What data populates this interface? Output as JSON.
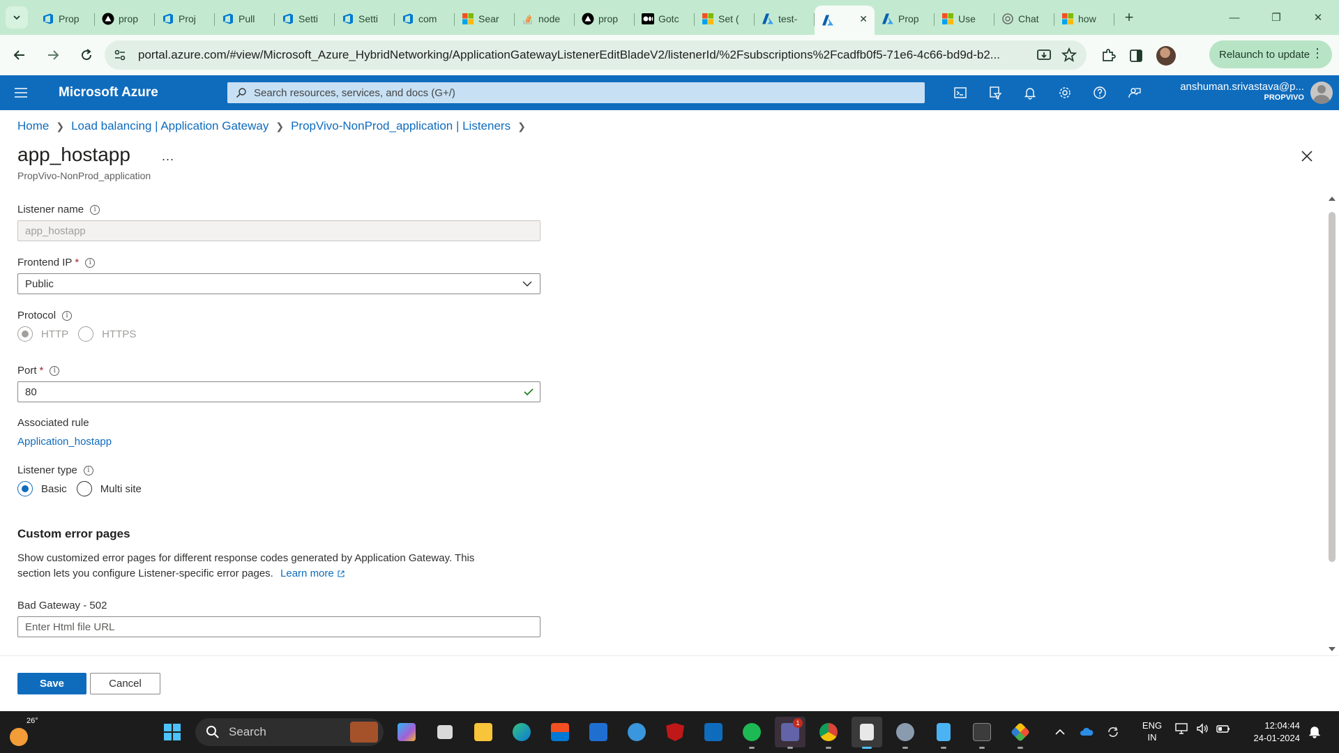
{
  "browser": {
    "tabs": [
      {
        "title": "Prop",
        "icon": "azure-devops-icon",
        "color": "#0078d4"
      },
      {
        "title": "prop",
        "icon": "vercel-icon",
        "color": "#000000"
      },
      {
        "title": "Proj",
        "icon": "azure-devops-icon",
        "color": "#0078d4"
      },
      {
        "title": "Pull",
        "icon": "azure-devops-icon",
        "color": "#0078d4"
      },
      {
        "title": "Setti",
        "icon": "azure-devops-icon",
        "color": "#0078d4"
      },
      {
        "title": "Setti",
        "icon": "azure-devops-icon",
        "color": "#0078d4"
      },
      {
        "title": "com",
        "icon": "azure-devops-icon",
        "color": "#0078d4"
      },
      {
        "title": "Sear",
        "icon": "microsoft-icon",
        "color": "#f25022"
      },
      {
        "title": "node",
        "icon": "stackoverflow-icon",
        "color": "#f48024"
      },
      {
        "title": "prop",
        "icon": "vercel-icon",
        "color": "#000000"
      },
      {
        "title": "Gotc",
        "icon": "medium-icon",
        "color": "#000000"
      },
      {
        "title": "Set (",
        "icon": "microsoft-icon",
        "color": "#f25022"
      },
      {
        "title": "test-",
        "icon": "azure-icon",
        "color": "#0078d4"
      },
      {
        "title": "",
        "icon": "azure-icon",
        "color": "#0078d4",
        "active": true
      },
      {
        "title": "Prop",
        "icon": "azure-icon",
        "color": "#0078d4"
      },
      {
        "title": "Use",
        "icon": "microsoft-icon",
        "color": "#f25022"
      },
      {
        "title": "Chat",
        "icon": "openai-icon",
        "color": "#6b6b6b"
      },
      {
        "title": "how",
        "icon": "microsoft-icon",
        "color": "#f25022"
      }
    ],
    "url": "portal.azure.com/#view/Microsoft_Azure_HybridNetworking/ApplicationGatewayListenerEditBladeV2/listenerId/%2Fsubscriptions%2Fcadfb0f5-71e6-4c66-bd9d-b2...",
    "relaunch_label": "Relaunch to update"
  },
  "azure": {
    "brand": "Microsoft Azure",
    "search_placeholder": "Search resources, services, and docs (G+/)",
    "account_name": "anshuman.srivastava@p...",
    "account_org": "PROPVIVO"
  },
  "breadcrumb": [
    "Home",
    "Load balancing | Application Gateway",
    "PropVivo-NonProd_application | Listeners"
  ],
  "blade": {
    "title": "app_hostapp",
    "more": "...",
    "subtitle": "PropVivo-NonProd_application"
  },
  "form": {
    "listener_name_label": "Listener name",
    "listener_name_value": "app_hostapp",
    "frontend_ip_label": "Frontend IP",
    "frontend_ip_value": "Public",
    "protocol_label": "Protocol",
    "protocol_http": "HTTP",
    "protocol_https": "HTTPS",
    "port_label": "Port",
    "port_value": "80",
    "assoc_rule_label": "Associated rule",
    "assoc_rule_link": "Application_hostapp",
    "listener_type_label": "Listener type",
    "type_basic": "Basic",
    "type_multi": "Multi site",
    "required_mark": "*",
    "custom_error_title": "Custom error pages",
    "custom_error_desc_1": "Show customized error pages for different response codes generated by Application Gateway. This",
    "custom_error_desc_2": "section lets you configure Listener-specific error pages.",
    "learn_more": "Learn more",
    "bad_gateway_label": "Bad Gateway - 502",
    "bad_gateway_placeholder": "Enter Html file URL"
  },
  "footer": {
    "save": "Save",
    "cancel": "Cancel"
  },
  "taskbar": {
    "temperature": "26°",
    "search_label": "Search",
    "teams_badge": "1",
    "lang_1": "ENG",
    "lang_2": "IN",
    "time": "12:04:44",
    "date": "24-01-2024"
  },
  "colors": {
    "azure_blue": "#0f6cbd",
    "browser_chrome": "#c3ead0",
    "valid_check": "#107c10"
  }
}
